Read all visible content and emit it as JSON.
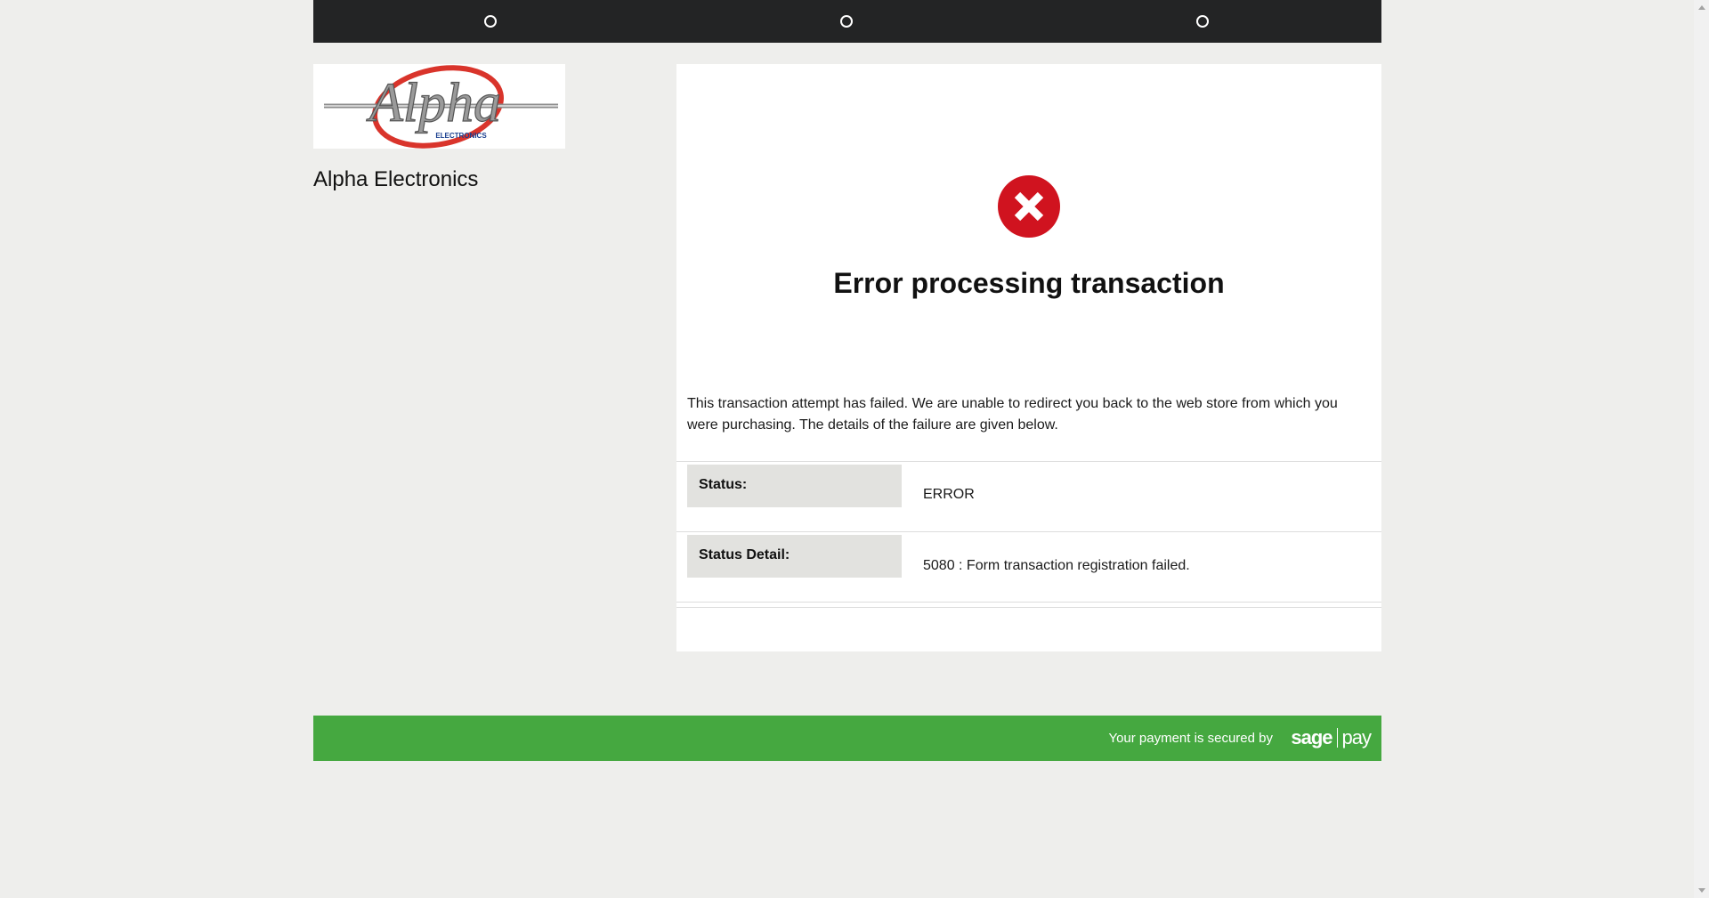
{
  "steps": [
    {
      "name": "step-1"
    },
    {
      "name": "step-2"
    },
    {
      "name": "step-3"
    }
  ],
  "merchant": {
    "logo_text": "Alpha",
    "logo_subtext": "ELECTRONICS",
    "name": "Alpha Electronics"
  },
  "error": {
    "icon": "error-x-icon",
    "title": "Error processing transaction",
    "message": "This transaction attempt has failed. We are unable to redirect you back to the web store from which you were purchasing. The details of the failure are given below."
  },
  "details": [
    {
      "label": "Status:",
      "value": "ERROR"
    },
    {
      "label": "Status Detail:",
      "value": "5080 : Form transaction registration failed."
    }
  ],
  "footer": {
    "secured_text": "Your payment is secured by",
    "brand_left": "sage",
    "brand_right": "pay"
  },
  "colors": {
    "topbar": "#232425",
    "footer": "#45a840",
    "error_red": "#d0131f",
    "background": "#eeeeec"
  }
}
